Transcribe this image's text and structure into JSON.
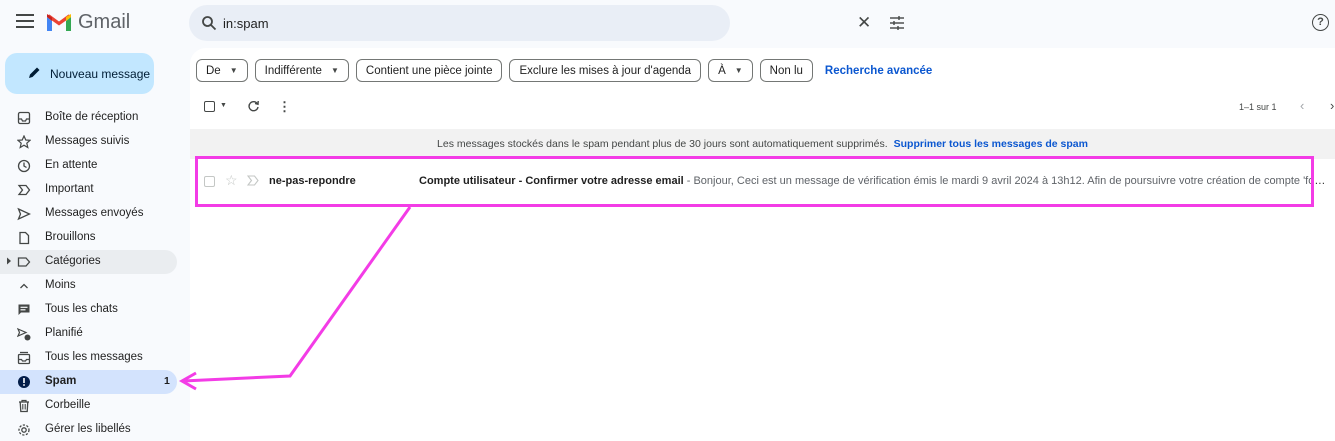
{
  "app": {
    "name": "Gmail"
  },
  "search": {
    "value": "in:spam"
  },
  "compose": {
    "label": "Nouveau message"
  },
  "sidebar": {
    "items": [
      {
        "label": "Boîte de réception",
        "icon": "inbox-icon"
      },
      {
        "label": "Messages suivis",
        "icon": "star-icon"
      },
      {
        "label": "En attente",
        "icon": "clock-icon"
      },
      {
        "label": "Important",
        "icon": "important-icon"
      },
      {
        "label": "Messages envoyés",
        "icon": "send-icon"
      },
      {
        "label": "Brouillons",
        "icon": "draft-icon"
      },
      {
        "label": "Catégories",
        "icon": "label-icon"
      },
      {
        "label": "Moins",
        "icon": "chevron-up-icon"
      },
      {
        "label": "Tous les chats",
        "icon": "chat-icon"
      },
      {
        "label": "Planifié",
        "icon": "scheduled-icon"
      },
      {
        "label": "Tous les messages",
        "icon": "all-mail-icon"
      },
      {
        "label": "Spam",
        "icon": "spam-icon",
        "count": "1"
      },
      {
        "label": "Corbeille",
        "icon": "trash-icon"
      },
      {
        "label": "Gérer les libellés",
        "icon": "manage-labels-icon"
      }
    ]
  },
  "filters": {
    "from": "De",
    "any_time": "Indifférente",
    "has_attachment": "Contient une pièce jointe",
    "exclude_calendar": "Exclure les mises à jour d'agenda",
    "to": "À",
    "unread": "Non lu",
    "advanced": "Recherche avancée"
  },
  "toolbar": {
    "pager": "1–1 sur 1"
  },
  "notice": {
    "text": "Les messages stockés dans le spam pendant plus de 30 jours sont automatiquement supprimés.",
    "link": "Supprimer tous les messages de spam"
  },
  "emails": [
    {
      "sender": "ne-pas-repondre",
      "subject": "Compte utilisateur - Confirmer votre adresse email",
      "snippet": " - Bonjour, Ceci est un message de vérification émis le mardi 9 avril 2024 à 13h12. Afin de poursuivre votre création de compte 'formlou…"
    }
  ],
  "annotation": {
    "color": "#f33ce6"
  },
  "colors": {
    "accent": "#0b57d0",
    "compose_bg": "#c2e7ff",
    "active_nav_bg": "#d3e3fd"
  }
}
